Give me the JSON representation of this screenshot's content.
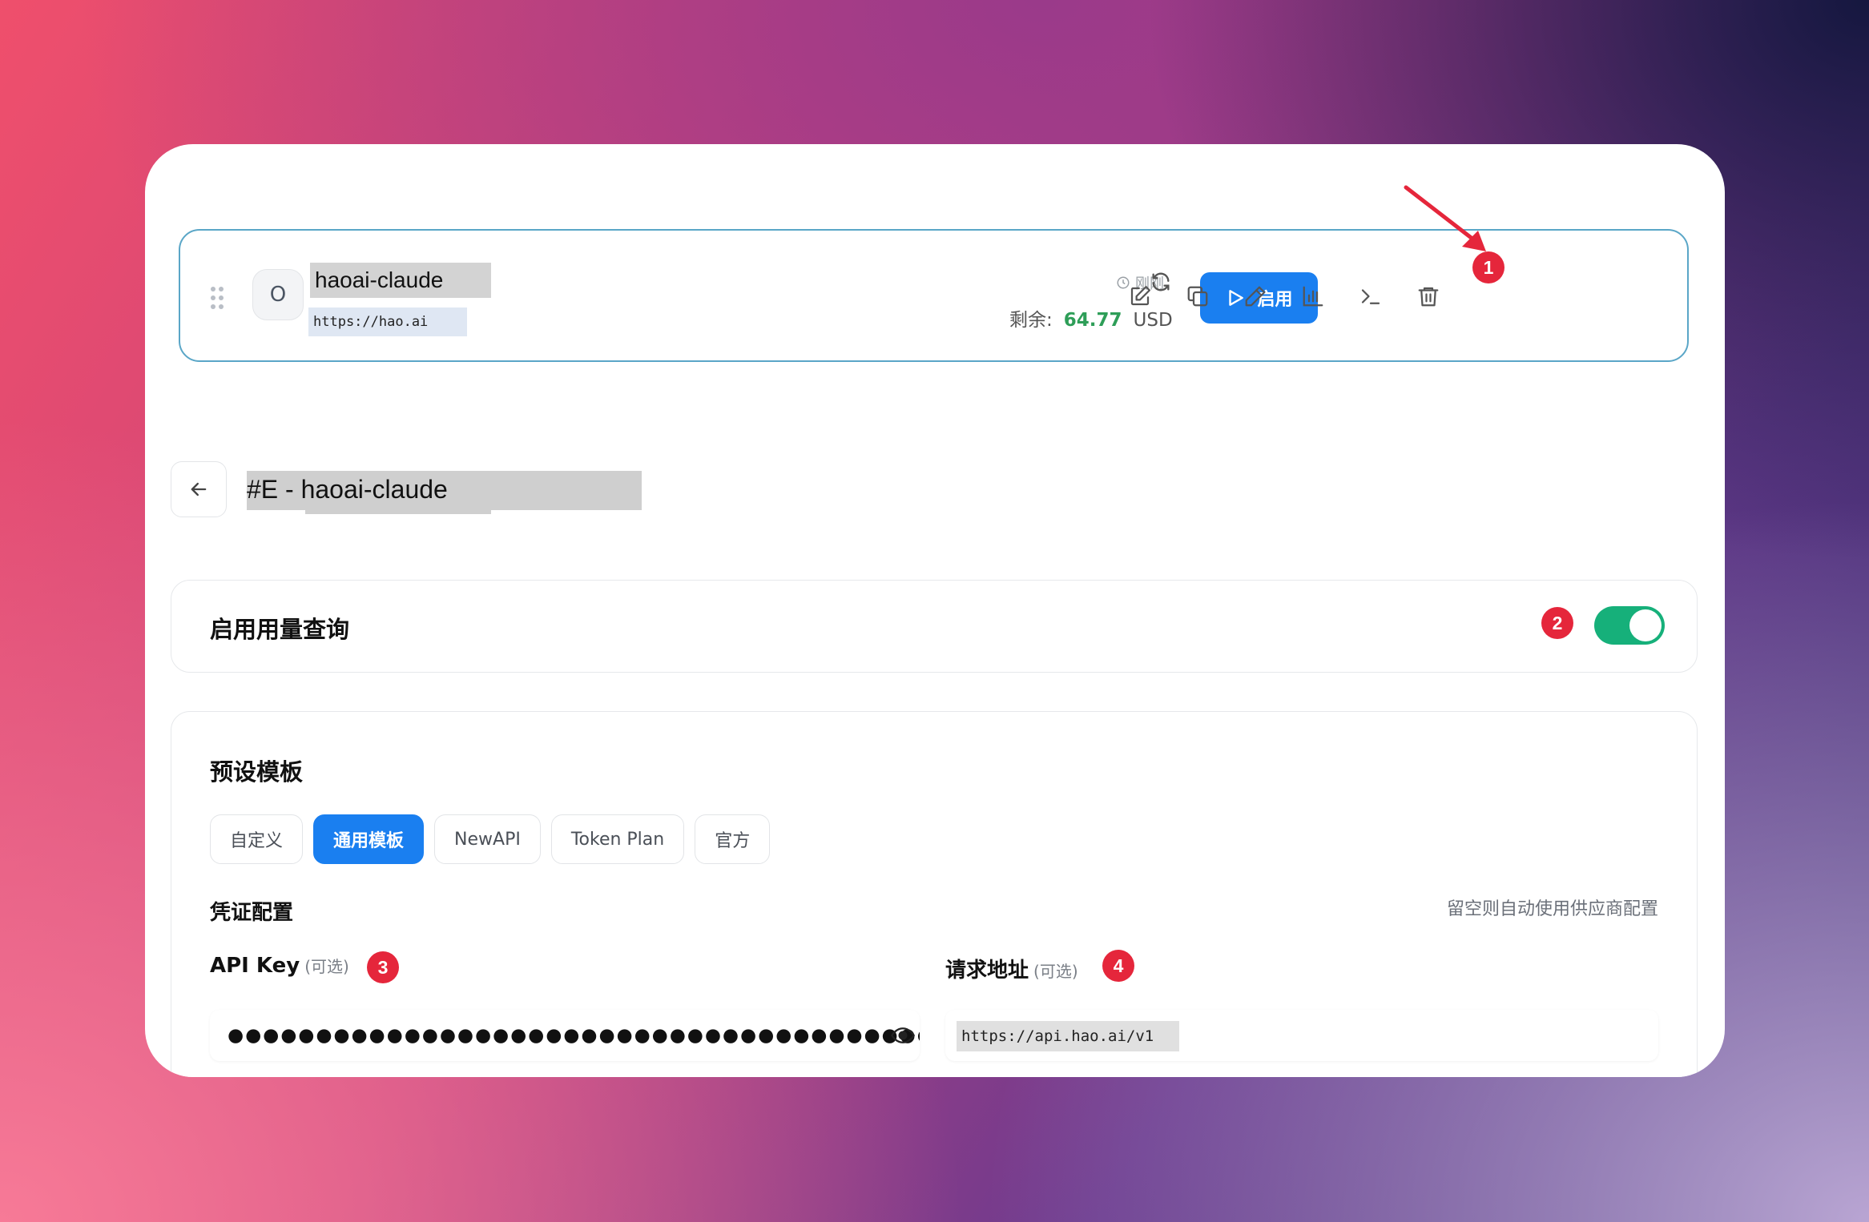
{
  "provider": {
    "avatar_letter": "O",
    "name": "haoai-claude",
    "url": "https://hao.ai",
    "updated": "刚刚",
    "remain_label": "剩余:",
    "remain_amount": "64.77",
    "remain_unit": "USD",
    "enable_label": "启用",
    "icons": [
      "edit-icon",
      "copy-icon",
      "pen-icon",
      "bar-chart-icon",
      "terminal-icon",
      "trash-icon"
    ]
  },
  "page": {
    "title": "#E - haoai-claude"
  },
  "usage": {
    "label": "启用用量查询",
    "enabled": true
  },
  "templates": {
    "title": "预设模板",
    "tabs": [
      "自定义",
      "通用模板",
      "NewAPI",
      "Token Plan",
      "官方"
    ],
    "active": "通用模板"
  },
  "credentials": {
    "title": "凭证配置",
    "hint": "留空则自动使用供应商配置",
    "api_key_label": "API Key",
    "api_key_optional": "(可选)",
    "api_key_value": "●●●●●●●●●●●●●●●●●●●●●●●●●●●●●●●●●●●●●●●●●●●●●●●●●●",
    "url_label": "请求地址",
    "url_optional": "(可选)",
    "url_value": "https://api.hao.ai/v1"
  },
  "annotations": [
    "1",
    "2",
    "3",
    "4"
  ],
  "colors": {
    "accent": "#1a7ff0",
    "toggle_on": "#16b07a",
    "amount": "#2e9e58",
    "badge": "#e5263b"
  }
}
